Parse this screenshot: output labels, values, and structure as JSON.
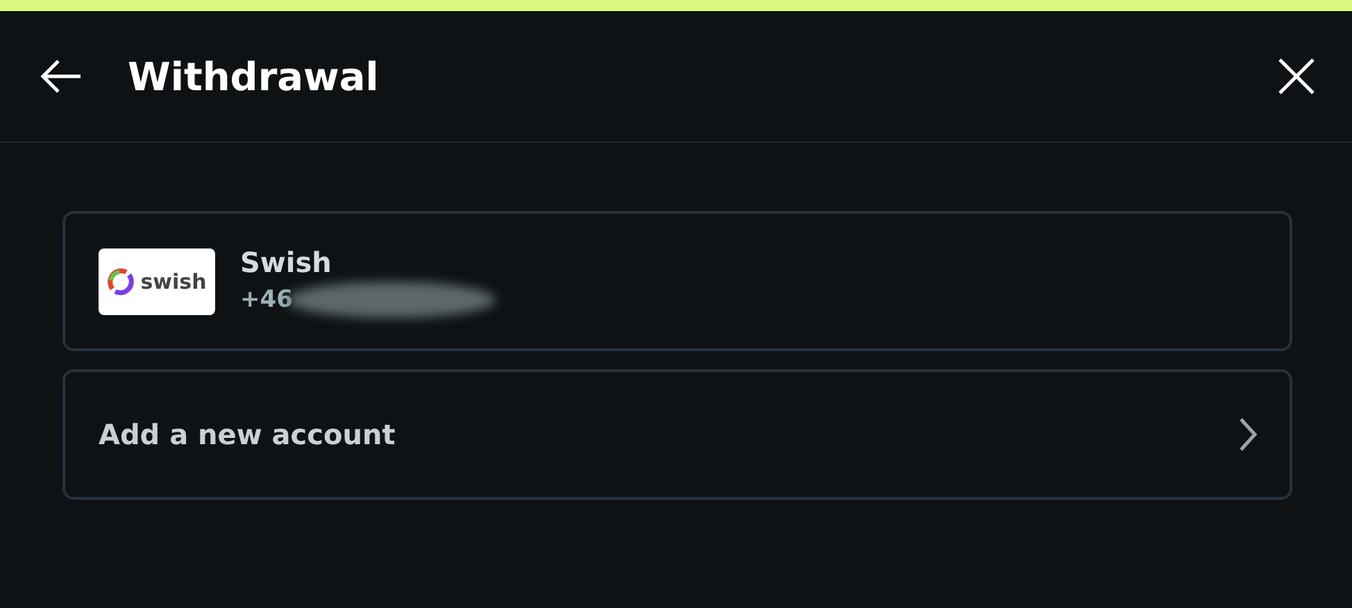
{
  "header": {
    "title": "Withdrawal"
  },
  "accounts": [
    {
      "logo_text": "swish",
      "name": "Swish",
      "number": "+46",
      "redacted": true
    }
  ],
  "add_account": {
    "label": "Add a new account"
  }
}
